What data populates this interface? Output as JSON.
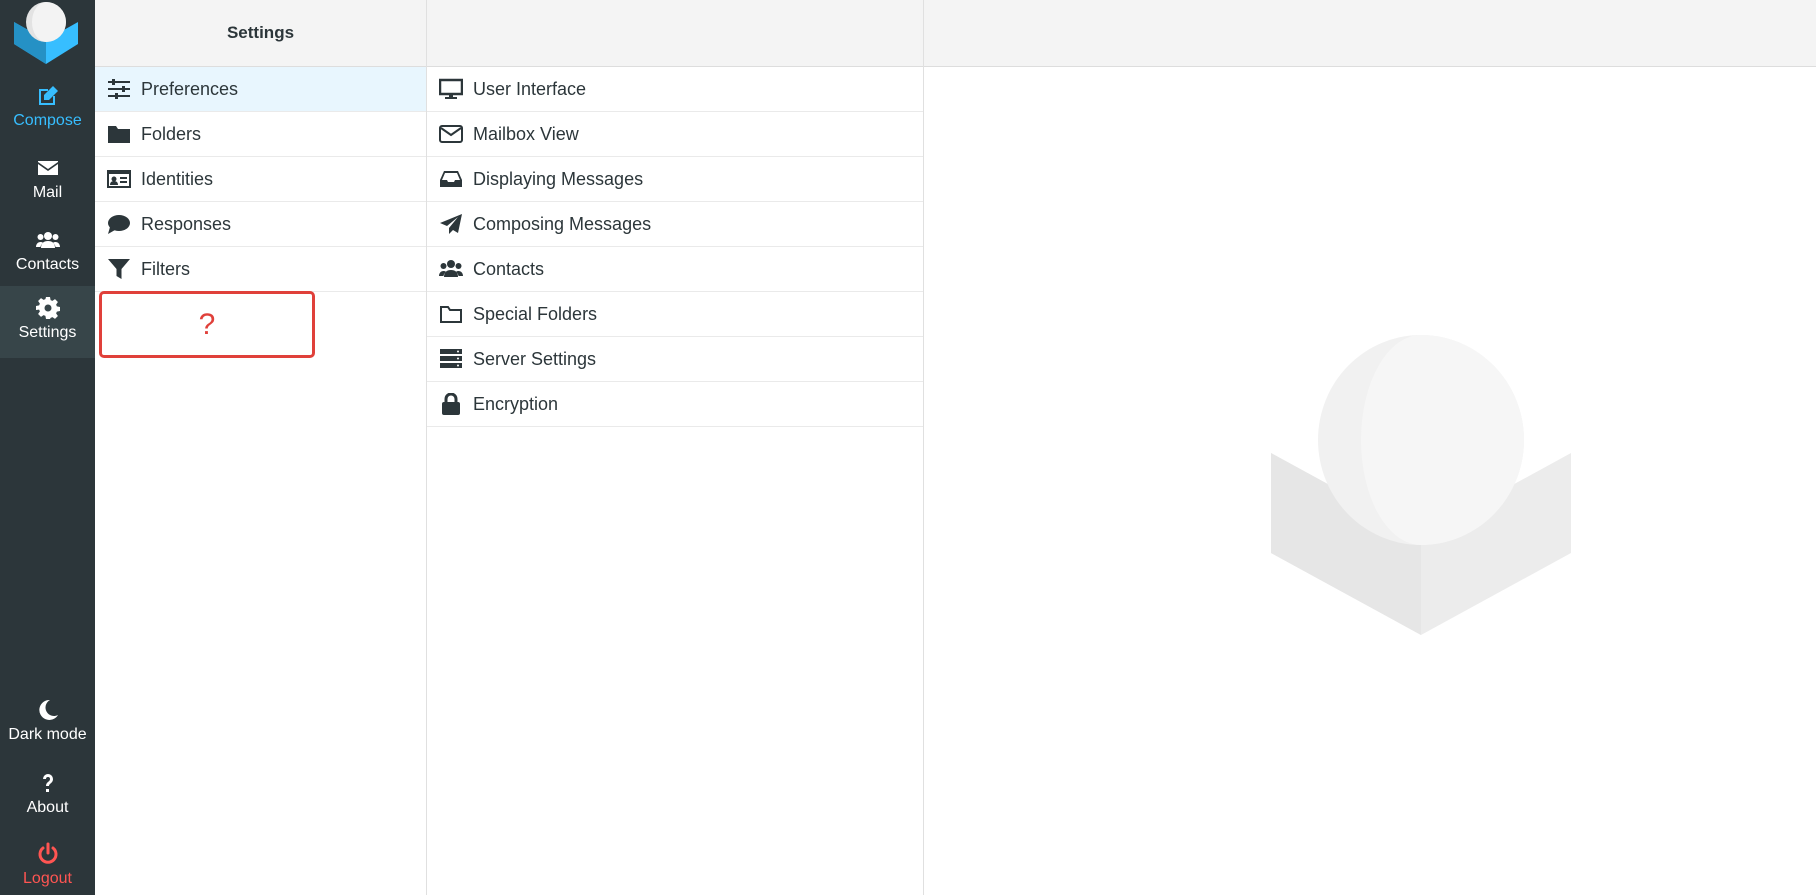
{
  "rail": {
    "compose": "Compose",
    "mail": "Mail",
    "contacts": "Contacts",
    "settings": "Settings",
    "dark_mode": "Dark mode",
    "about": "About",
    "logout": "Logout"
  },
  "settings_col": {
    "title": "Settings",
    "items": [
      {
        "label": "Preferences"
      },
      {
        "label": "Folders"
      },
      {
        "label": "Identities"
      },
      {
        "label": "Responses"
      },
      {
        "label": "Filters"
      }
    ],
    "unknown_glyph": "?"
  },
  "sections": {
    "items": [
      {
        "label": "User Interface"
      },
      {
        "label": "Mailbox View"
      },
      {
        "label": "Displaying Messages"
      },
      {
        "label": "Composing Messages"
      },
      {
        "label": "Contacts"
      },
      {
        "label": "Special Folders"
      },
      {
        "label": "Server Settings"
      },
      {
        "label": "Encryption"
      }
    ]
  },
  "colors": {
    "rail_bg": "#2c363a",
    "accent": "#37beff",
    "logout": "#ff5552",
    "highlight_box": "#e0403a"
  }
}
